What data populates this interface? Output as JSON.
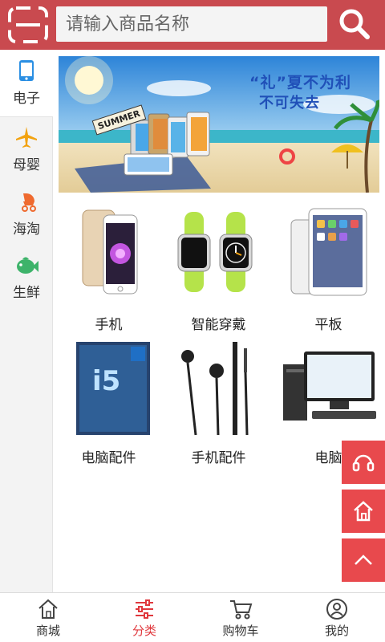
{
  "header": {
    "search_placeholder": "请输入商品名称",
    "scan_icon": "scan-icon",
    "search_icon": "search-icon"
  },
  "sidebar": {
    "items": [
      {
        "label": "电子",
        "icon": "phone-icon",
        "active": true
      },
      {
        "label": "母婴",
        "icon": "airplane-icon"
      },
      {
        "label": "海淘",
        "icon": "stroller-icon"
      },
      {
        "label": "生鲜",
        "icon": "fish-icon"
      }
    ]
  },
  "banner": {
    "headline": "“礼”夏不为利",
    "subline": "不可失去",
    "sign": "SUMMER"
  },
  "categories": [
    {
      "label": "手机"
    },
    {
      "label": "智能穿戴"
    },
    {
      "label": "平板"
    },
    {
      "label": "电脑配件"
    },
    {
      "label": "手机配件"
    },
    {
      "label": "电脑"
    }
  ],
  "bottom_nav": [
    {
      "label": "商城",
      "icon": "home-icon"
    },
    {
      "label": "分类",
      "icon": "sliders-icon",
      "active": true
    },
    {
      "label": "购物车",
      "icon": "cart-icon"
    },
    {
      "label": "我的",
      "icon": "user-icon"
    }
  ],
  "colors": {
    "brand": "#c94a4f",
    "accent": "#e8494d",
    "active_text": "#e0383d"
  }
}
